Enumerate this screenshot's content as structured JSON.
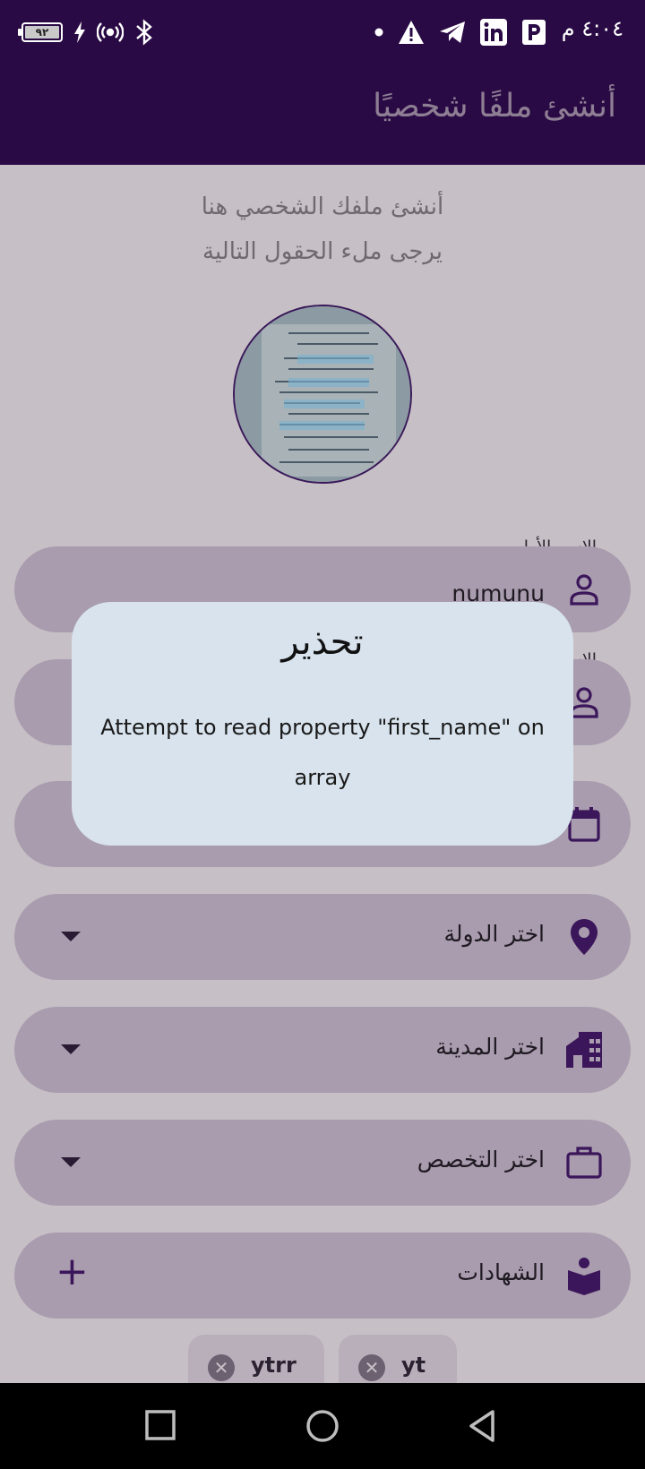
{
  "status_bar": {
    "time": "٤:٠٤ م",
    "battery": "٩٢",
    "icons": [
      "battery-charging-icon",
      "hotspot-icon",
      "bluetooth-icon",
      "dot-icon",
      "warning-icon",
      "telegram-icon",
      "linkedin-icon",
      "parking-icon"
    ]
  },
  "app_bar": {
    "title": "أنشئ ملفًا شخصيًا"
  },
  "intro": {
    "line1": "أنشئ ملفك الشخصي هنا",
    "line2": "يرجى ملء الحقول التالية"
  },
  "form": {
    "first_name": {
      "label": "الاسم الأول",
      "value": "numunu",
      "icon": "person-icon"
    },
    "last_name": {
      "label": "الاسم",
      "icon": "person-icon"
    },
    "birth_date": {
      "icon": "calendar-icon"
    },
    "country": {
      "placeholder": "اختر الدولة",
      "icon": "location-pin-icon"
    },
    "city": {
      "placeholder": "اختر المدينة",
      "icon": "city-icon"
    },
    "specialty": {
      "placeholder": "اختر التخصص",
      "icon": "briefcase-icon"
    },
    "certificates": {
      "label": "الشهادات",
      "icon": "book-reader-icon"
    }
  },
  "chips": [
    {
      "text": "yt"
    },
    {
      "text": "ytrr"
    }
  ],
  "dialog": {
    "title": "تحذير",
    "message": "Attempt to read property \"first_name\" on array"
  },
  "nav": [
    "square-recent-icon",
    "circle-home-icon",
    "triangle-back-icon"
  ],
  "colors": {
    "primary": "#2a0a45",
    "dialog_bg": "#d8e3ed",
    "field_bg": "#a99cae"
  }
}
